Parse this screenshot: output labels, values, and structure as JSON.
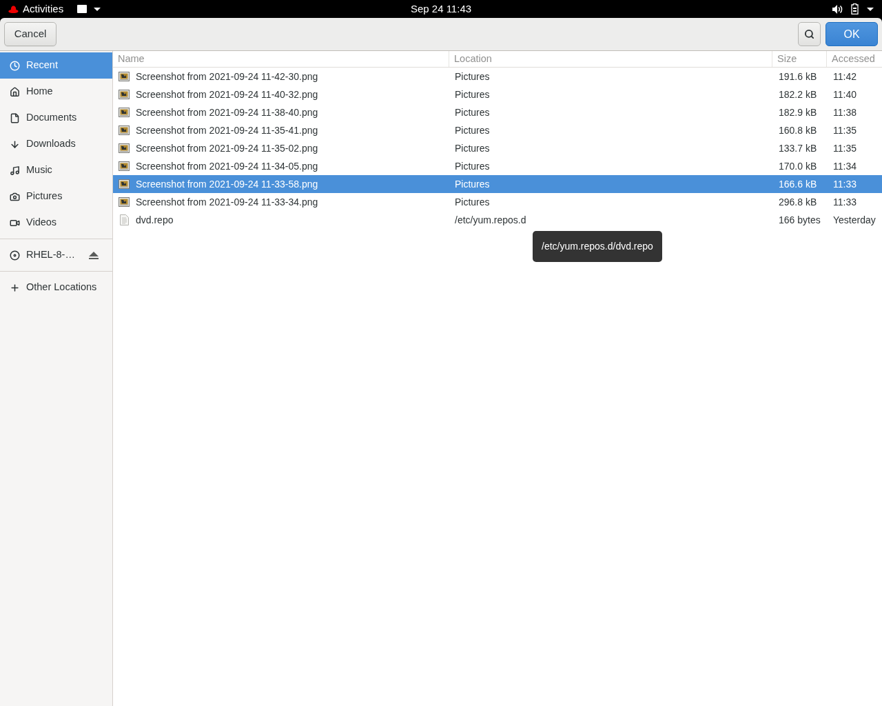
{
  "top_bar": {
    "activities": "Activities",
    "clock": "Sep 24 11:43"
  },
  "header_bar": {
    "cancel_button": "Cancel",
    "ok_button": "OK"
  },
  "sidebar": {
    "groups": [
      {
        "items": [
          {
            "label": "Recent",
            "selected": true
          },
          {
            "label": "Home",
            "selected": false
          },
          {
            "label": "Documents",
            "selected": false
          },
          {
            "label": "Downloads",
            "selected": false
          },
          {
            "label": "Music",
            "selected": false
          },
          {
            "label": "Pictures",
            "selected": false
          },
          {
            "label": "Videos",
            "selected": false
          }
        ]
      },
      {
        "items": [
          {
            "label": "RHEL-8-…",
            "selected": false,
            "ejectable": true
          }
        ]
      },
      {
        "items": [
          {
            "label": "Other Locations",
            "selected": false
          }
        ]
      }
    ]
  },
  "file_list": {
    "columns": [
      "Name",
      "Location",
      "Size",
      "Accessed"
    ],
    "rows": [
      {
        "kind": "image",
        "name": "Screenshot from 2021-09-24 11-42-30.png",
        "location": "Pictures",
        "size": "191.6 kB",
        "accessed": "11:42",
        "selected": false
      },
      {
        "kind": "image",
        "name": "Screenshot from 2021-09-24 11-40-32.png",
        "location": "Pictures",
        "size": "182.2 kB",
        "accessed": "11:40",
        "selected": false
      },
      {
        "kind": "image",
        "name": "Screenshot from 2021-09-24 11-38-40.png",
        "location": "Pictures",
        "size": "182.9 kB",
        "accessed": "11:38",
        "selected": false
      },
      {
        "kind": "image",
        "name": "Screenshot from 2021-09-24 11-35-41.png",
        "location": "Pictures",
        "size": "160.8 kB",
        "accessed": "11:35",
        "selected": false
      },
      {
        "kind": "image",
        "name": "Screenshot from 2021-09-24 11-35-02.png",
        "location": "Pictures",
        "size": "133.7 kB",
        "accessed": "11:35",
        "selected": false
      },
      {
        "kind": "image",
        "name": "Screenshot from 2021-09-24 11-34-05.png",
        "location": "Pictures",
        "size": "170.0 kB",
        "accessed": "11:34",
        "selected": false
      },
      {
        "kind": "image",
        "name": "Screenshot from 2021-09-24 11-33-58.png",
        "location": "Pictures",
        "size": "166.6 kB",
        "accessed": "11:33",
        "selected": true
      },
      {
        "kind": "image",
        "name": "Screenshot from 2021-09-24 11-33-34.png",
        "location": "Pictures",
        "size": "296.8 kB",
        "accessed": "11:33",
        "selected": false
      },
      {
        "kind": "text",
        "name": "dvd.repo",
        "location": "/etc/yum.repos.d",
        "size": "166 bytes",
        "accessed": "Yesterday",
        "selected": false
      }
    ]
  },
  "tooltip": {
    "text": "/etc/yum.repos.d/dvd.repo"
  }
}
